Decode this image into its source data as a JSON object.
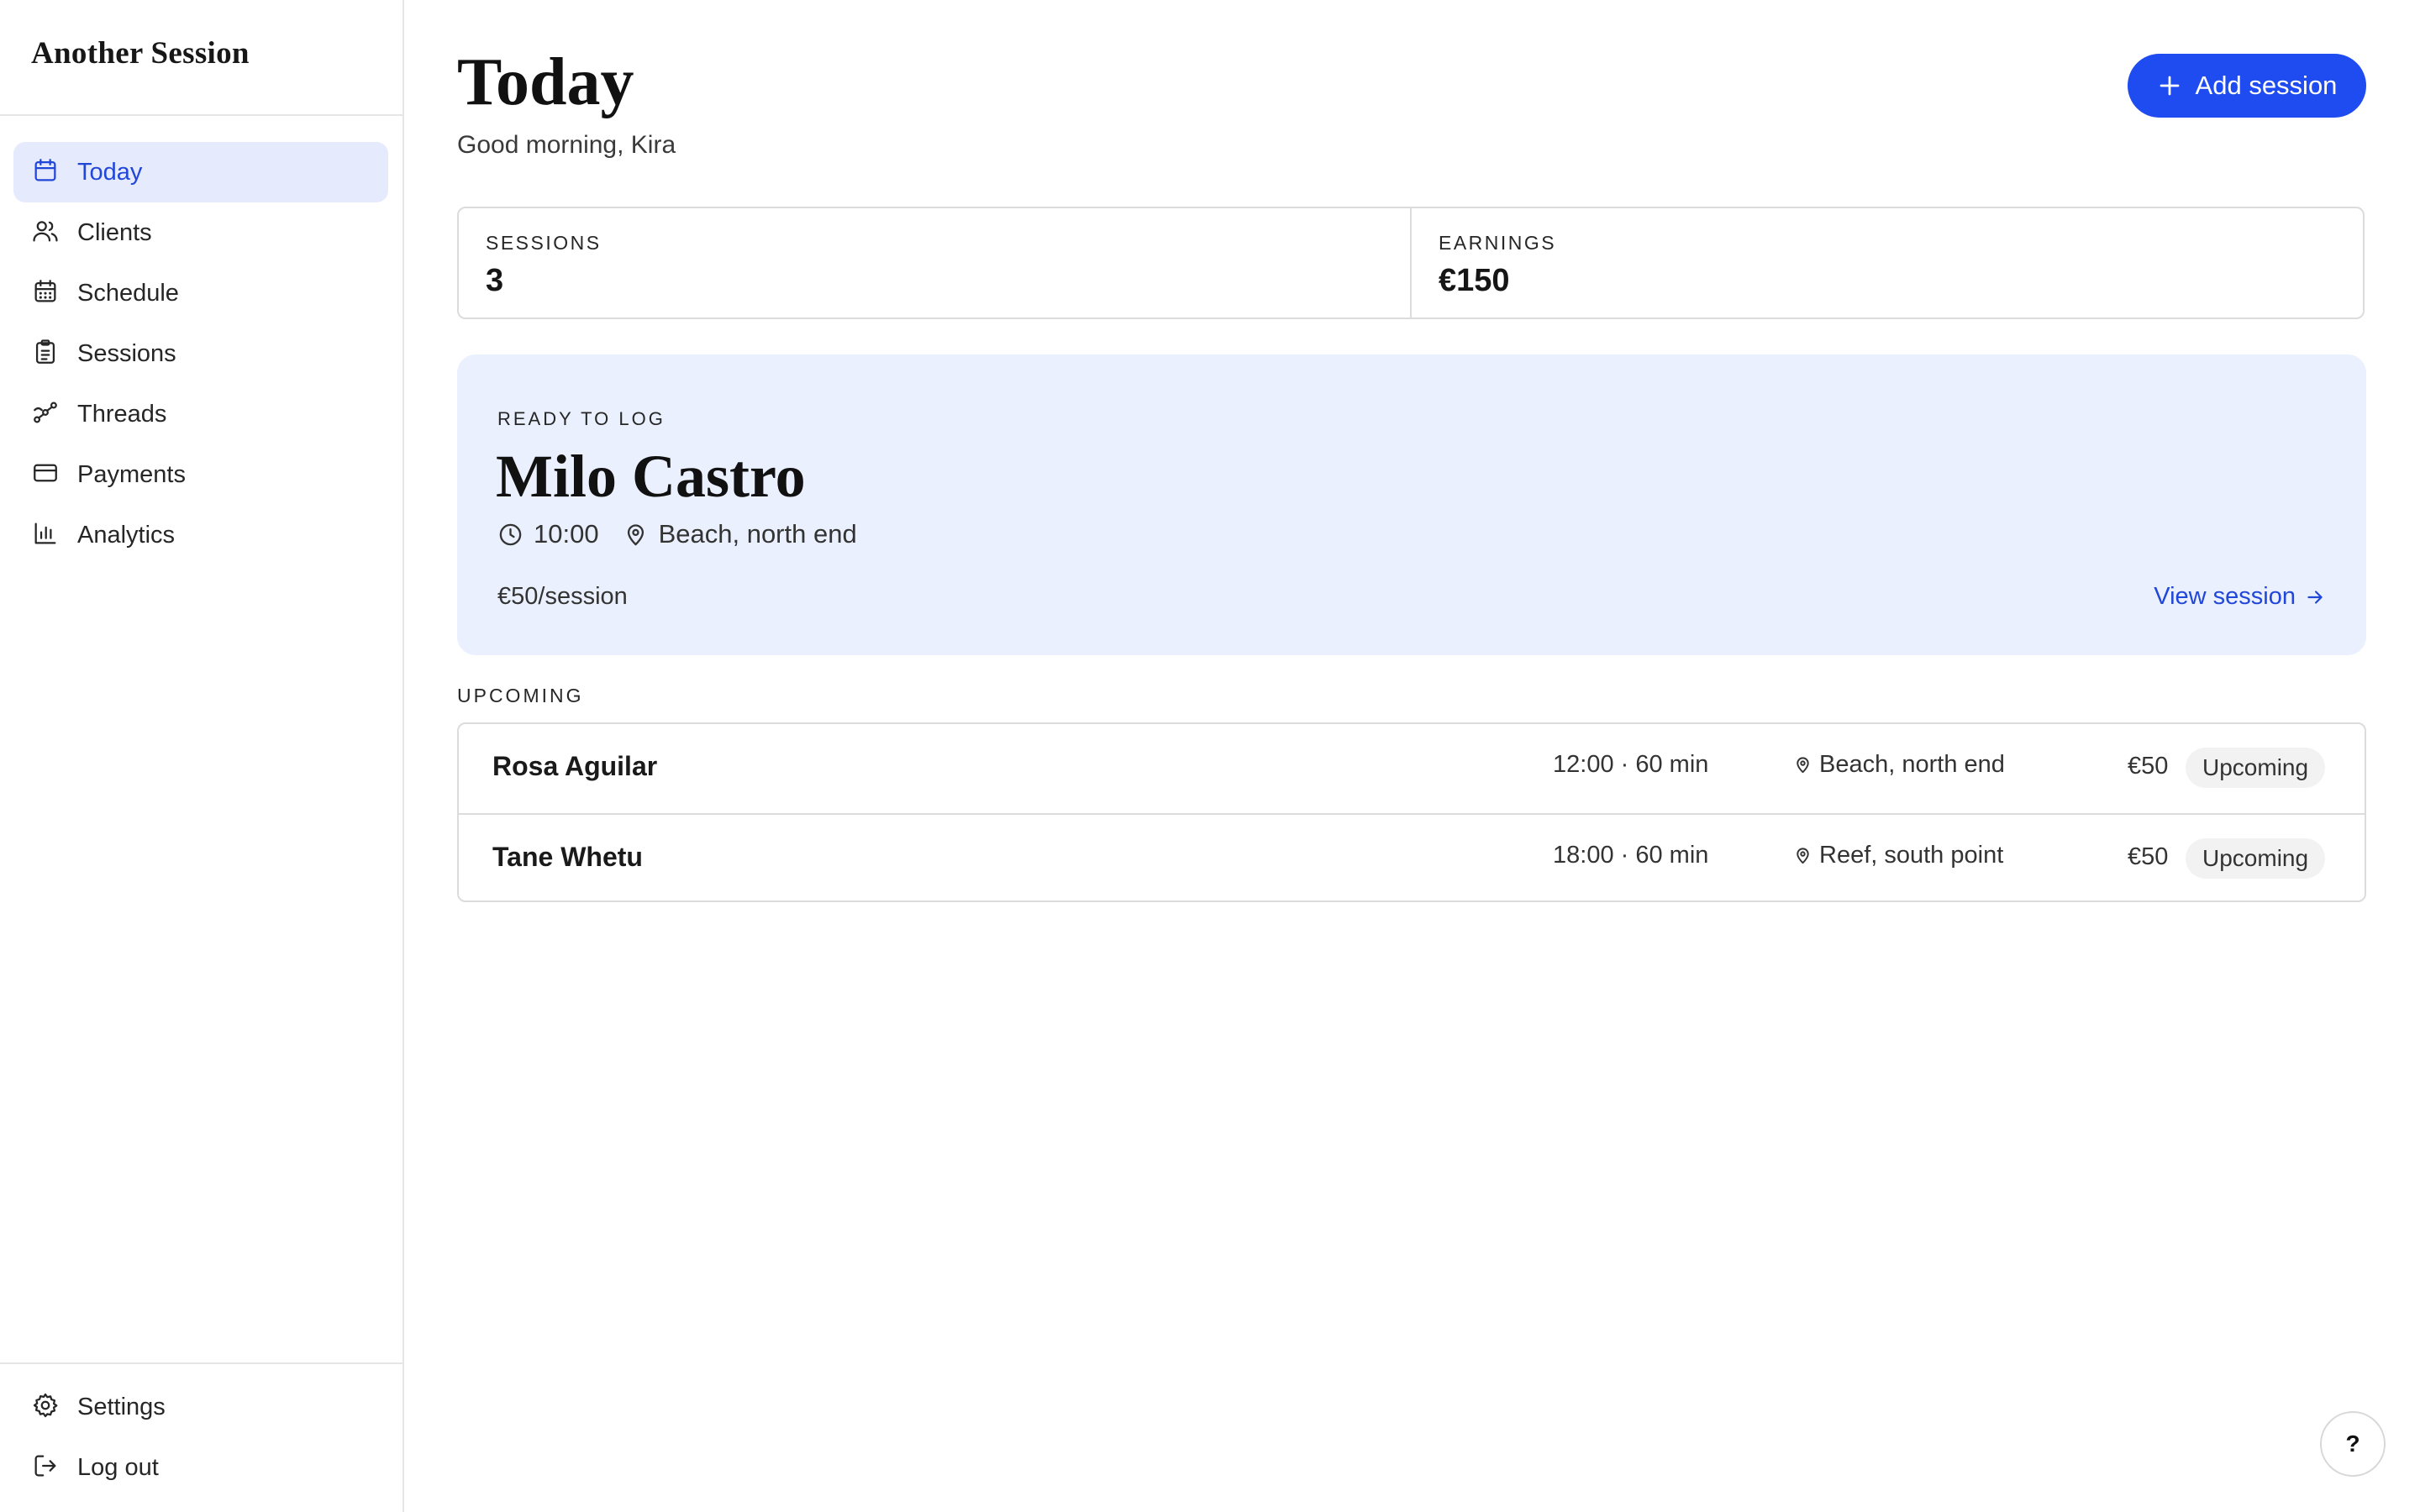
{
  "app": {
    "brand": "Another Session"
  },
  "sidebar": {
    "items": [
      {
        "label": "Today",
        "icon": "calendar-icon",
        "active": true
      },
      {
        "label": "Clients",
        "icon": "users-icon"
      },
      {
        "label": "Schedule",
        "icon": "calendar-grid-icon"
      },
      {
        "label": "Sessions",
        "icon": "clipboard-icon"
      },
      {
        "label": "Threads",
        "icon": "route-icon"
      },
      {
        "label": "Payments",
        "icon": "credit-card-icon"
      },
      {
        "label": "Analytics",
        "icon": "bar-chart-icon"
      }
    ],
    "bottom_items": [
      {
        "label": "Settings",
        "icon": "gear-icon"
      },
      {
        "label": "Log out",
        "icon": "logout-icon"
      }
    ]
  },
  "header": {
    "title": "Today",
    "greeting": "Good morning, Kira",
    "add_button_label": "Add session"
  },
  "stats": [
    {
      "label": "SESSIONS",
      "value": "3"
    },
    {
      "label": "EARNINGS",
      "value": "€150"
    }
  ],
  "ready_to_log": {
    "kicker": "READY TO LOG",
    "client": "Milo Castro",
    "time": "10:00",
    "location": "Beach, north end",
    "rate": "€50/session",
    "link_label": "View session"
  },
  "upcoming": {
    "label": "UPCOMING",
    "rows": [
      {
        "name": "Rosa Aguilar",
        "time": "12:00 · 60 min",
        "location": "Beach, north end",
        "price": "€50",
        "status": "Upcoming"
      },
      {
        "name": "Tane Whetu",
        "time": "18:00 · 60 min",
        "location": "Reef, south point",
        "price": "€50",
        "status": "Upcoming"
      }
    ]
  },
  "help": {
    "label": "?"
  },
  "colors": {
    "accent": "#1f4cf0",
    "active_nav_bg": "#e6eafd",
    "active_nav_text": "#2147d9",
    "feature_bg": "#eaf0fd",
    "badge_bg": "#f2f2f2",
    "border": "#dcdcdc"
  }
}
